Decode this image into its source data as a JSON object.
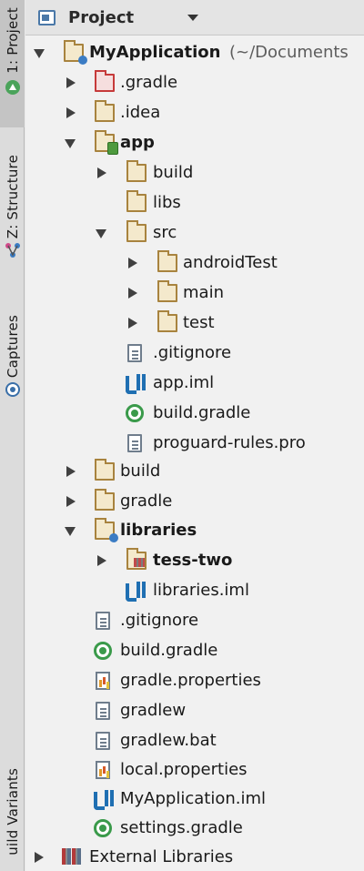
{
  "left_strip": {
    "tabs": [
      {
        "label": "1: Project",
        "active": true,
        "icon": "android-icon"
      },
      {
        "label": "Z: Structure",
        "active": false,
        "icon": "structure-icon"
      },
      {
        "label": "Captures",
        "active": false,
        "icon": "captures-icon"
      },
      {
        "label": "uild Variants",
        "active": false,
        "icon": ""
      }
    ]
  },
  "header": {
    "view_selector_label": "Project",
    "view_selector_icon": "project-view-icon"
  },
  "tree": {
    "root_name": "MyApplication",
    "root_path": " (~/Documents",
    "gradle_dir": ".gradle",
    "idea_dir": ".idea",
    "app": {
      "name": "app",
      "build": "build",
      "libs": "libs",
      "src": "src",
      "android_test": "androidTest",
      "main": "main",
      "test": "test",
      "gitignore": ".gitignore",
      "iml": "app.iml",
      "build_gradle": "build.gradle",
      "proguard": "proguard-rules.pro"
    },
    "build": "build",
    "gradle": "gradle",
    "libraries": {
      "name": "libraries",
      "tess_two": "tess-two",
      "iml": "libraries.iml"
    },
    "gitignore": ".gitignore",
    "build_gradle": "build.gradle",
    "gradle_properties": "gradle.properties",
    "gradlew": "gradlew",
    "gradlew_bat": "gradlew.bat",
    "local_properties": "local.properties",
    "project_iml": "MyApplication.iml",
    "settings_gradle": "settings.gradle",
    "external_libraries": "External Libraries"
  },
  "colors": {
    "folder": "#a8833e",
    "excluded_folder": "#c63a3a",
    "gradle": "#3a9a4a",
    "iml": "#1f6fb2"
  }
}
